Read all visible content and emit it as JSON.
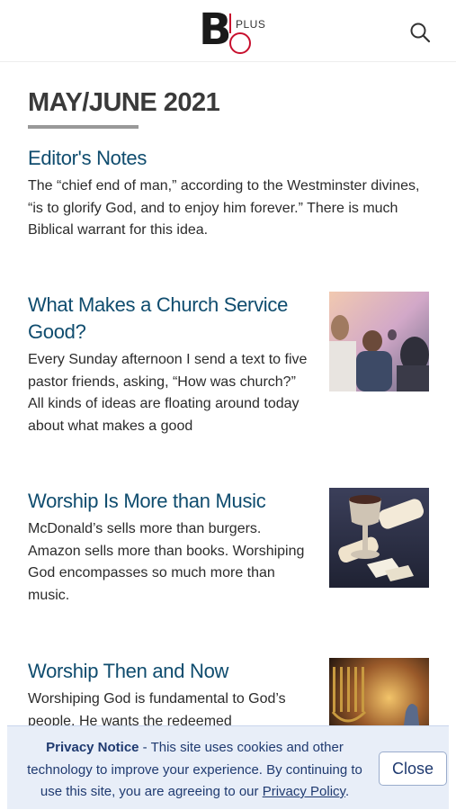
{
  "header": {
    "logo_letter": "B",
    "logo_plus": "PLUS"
  },
  "issue": {
    "title": "MAY/JUNE 2021"
  },
  "articles": [
    {
      "title": "Editor's Notes",
      "excerpt": "The “chief end of man,” according to the Westminster divines, “is to glorify God, and to enjoy him forever.” There is much Biblical warrant for this idea."
    },
    {
      "title": "What Makes a Church Service Good?",
      "excerpt": "Every Sunday afternoon I send a text to five pastor friends, asking, “How was church?” All kinds of ideas are floating around today about what makes a good"
    },
    {
      "title": "Worship Is More than Music",
      "excerpt": "McDonald’s sells more than burgers. Amazon sells more than books. Worshiping God encompasses so much more than music."
    },
    {
      "title": "Worship Then and Now",
      "excerpt": "Worshiping God is fundamental to God’s people. He wants the redeemed"
    }
  ],
  "privacy": {
    "heading": "Privacy Notice",
    "text": " - This site uses cookies and other technology to improve your experience. By continuing to use this site, you are agreeing to our ",
    "link": "Privacy Policy",
    "end": ".",
    "close_label": "Close"
  }
}
